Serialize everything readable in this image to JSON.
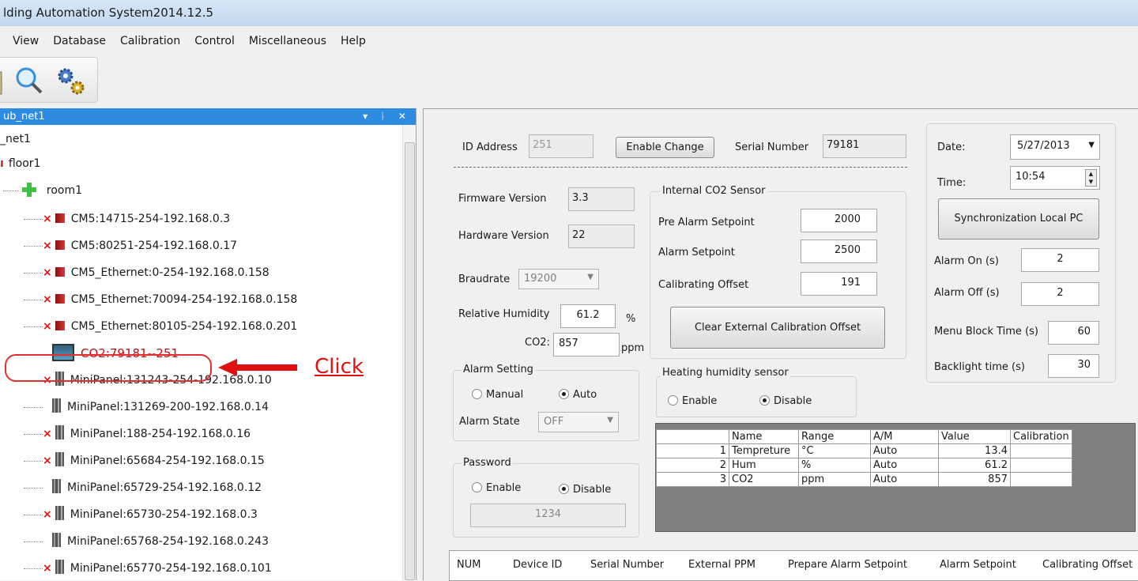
{
  "window_title": "lding Automation System2014.12.5",
  "menu": [
    "View",
    "Database",
    "Calibration",
    "Control",
    "Miscellaneous",
    "Help"
  ],
  "left_pane": {
    "title": "ub_net1",
    "header_buttons": "▾ ᚿ ✕",
    "tree": {
      "network": "_net1",
      "floor": "floor1",
      "room": "room1",
      "devices": [
        {
          "label": "CM5:14715-254-192.168.0.3",
          "icon": "cm5-device-icon",
          "error": true
        },
        {
          "label": "CM5:80251-254-192.168.0.17",
          "icon": "cm5-device-icon",
          "error": true
        },
        {
          "label": "CM5_Ethernet:0-254-192.168.0.158",
          "icon": "cm5-device-icon",
          "error": true
        },
        {
          "label": "CM5_Ethernet:70094-254-192.168.0.158",
          "icon": "cm5-device-icon",
          "error": true
        },
        {
          "label": "CM5_Ethernet:80105-254-192.168.0.201",
          "icon": "cm5-device-icon",
          "error": true
        },
        {
          "label": "CO2:79181--251",
          "icon": "co2-device-icon",
          "error": false,
          "selected": true
        },
        {
          "label": "MiniPanel:131243-254-192.168.0.10",
          "icon": "minipanel-icon",
          "error": true
        },
        {
          "label": "MiniPanel:131269-200-192.168.0.14",
          "icon": "minipanel-icon",
          "error": false
        },
        {
          "label": "MiniPanel:188-254-192.168.0.16",
          "icon": "minipanel-icon",
          "error": true
        },
        {
          "label": "MiniPanel:65684-254-192.168.0.15",
          "icon": "minipanel-icon",
          "error": true
        },
        {
          "label": "MiniPanel:65729-254-192.168.0.12",
          "icon": "minipanel-icon",
          "error": false
        },
        {
          "label": "MiniPanel:65730-254-192.168.0.3",
          "icon": "minipanel-icon",
          "error": true
        },
        {
          "label": "MiniPanel:65768-254-192.168.0.243",
          "icon": "minipanel-icon",
          "error": false
        },
        {
          "label": "MiniPanel:65770-254-192.168.0.101",
          "icon": "minipanel-icon",
          "error": true
        }
      ]
    },
    "annotation": "Click"
  },
  "device": {
    "id_address_label": "ID Address",
    "id_address": "251",
    "enable_change": "Enable Change",
    "serial_label": "Serial Number",
    "serial": "79181",
    "firmware_label": "Firmware Version",
    "firmware": "3.3",
    "hardware_label": "Hardware Version",
    "hardware": "22",
    "baudrate_label": "Braudrate",
    "baudrate": "19200",
    "rh_label": "Relative Humidity",
    "rh": "61.2",
    "rh_unit": "%",
    "co2_label": "CO2:",
    "co2": "857",
    "co2_unit": "ppm"
  },
  "internal_co2": {
    "title": "Internal CO2 Sensor",
    "pre_alarm_label": "Pre Alarm Setpoint",
    "pre_alarm": "2000",
    "alarm_label": "Alarm Setpoint",
    "alarm": "2500",
    "offset_label": "Calibrating Offset",
    "offset": "191",
    "clear_button": "Clear External Calibration Offset"
  },
  "alarm_setting": {
    "title": "Alarm Setting",
    "manual": "Manual",
    "auto": "Auto",
    "selected": "Auto",
    "state_label": "Alarm State",
    "state": "OFF"
  },
  "heating": {
    "title": "Heating humidity sensor",
    "enable": "Enable",
    "disable": "Disable",
    "selected": "Disable"
  },
  "password": {
    "title": "Password",
    "enable": "Enable",
    "disable": "Disable",
    "selected": "Disable",
    "value": "1234"
  },
  "datetime": {
    "date_label": "Date:",
    "date": "5/27/2013",
    "time_label": "Time:",
    "time": "10:54",
    "sync_button": "Synchronization Local PC",
    "alarm_on_label": "Alarm On (s)",
    "alarm_on": "2",
    "alarm_off_label": "Alarm Off (s)",
    "alarm_off": "2",
    "menu_block_label": "Menu Block Time (s)",
    "menu_block": "60",
    "backlight_label": "Backlight time (s)",
    "backlight": "30"
  },
  "sensor_table": {
    "headers": [
      "",
      "Name",
      "Range",
      "A/M",
      "Value",
      "Calibration"
    ],
    "rows": [
      [
        "1",
        "Tempreture",
        "°C",
        "Auto",
        "13.4",
        ""
      ],
      [
        "2",
        "Hum",
        "%",
        "Auto",
        "61.2",
        ""
      ],
      [
        "3",
        "CO2",
        "ppm",
        "Auto",
        "857",
        ""
      ]
    ]
  },
  "bottom_table": {
    "headers": [
      "NUM",
      "Device ID",
      "Serial Number",
      "External PPM",
      "Prepare Alarm Setpoint",
      "Alarm Setpoint",
      "Calibrating Offset"
    ]
  },
  "colors": {
    "pane_header": "#2e8ce0",
    "annotation": "#e01010"
  }
}
